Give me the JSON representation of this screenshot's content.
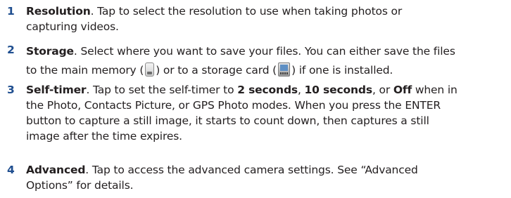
{
  "items": [
    {
      "number": "1",
      "title": "Resolution",
      "lines": [
        ". Tap to select the resolution to use when taking photos or",
        "capturing videos."
      ]
    },
    {
      "number": "2",
      "title": "Storage",
      "line1": ". Select where you want to save your files. You can either save the files",
      "line2_a": "to the main memory (",
      "line2_b": ") or to a storage card (",
      "line2_c": ") if one is installed.",
      "icons": [
        "phone-memory-icon",
        "storage-card-icon"
      ]
    },
    {
      "number": "3",
      "title": "Self-timer",
      "line1_a": ". Tap to set the self-timer to ",
      "opt1": "2 seconds",
      "sep1": ", ",
      "opt2": "10 seconds",
      "sep2": ", or ",
      "opt3": "Off",
      "line1_b": " when in",
      "lines": [
        "the Photo, Contacts Picture, or GPS Photo modes. When you press the ENTER",
        "button to capture a still image, it starts to count down, then captures a still",
        "image after the time expires."
      ]
    },
    {
      "number": "4",
      "title": "Advanced",
      "lines": [
        ". Tap to access the advanced camera settings. See “Advanced",
        "Options” for details."
      ]
    }
  ]
}
